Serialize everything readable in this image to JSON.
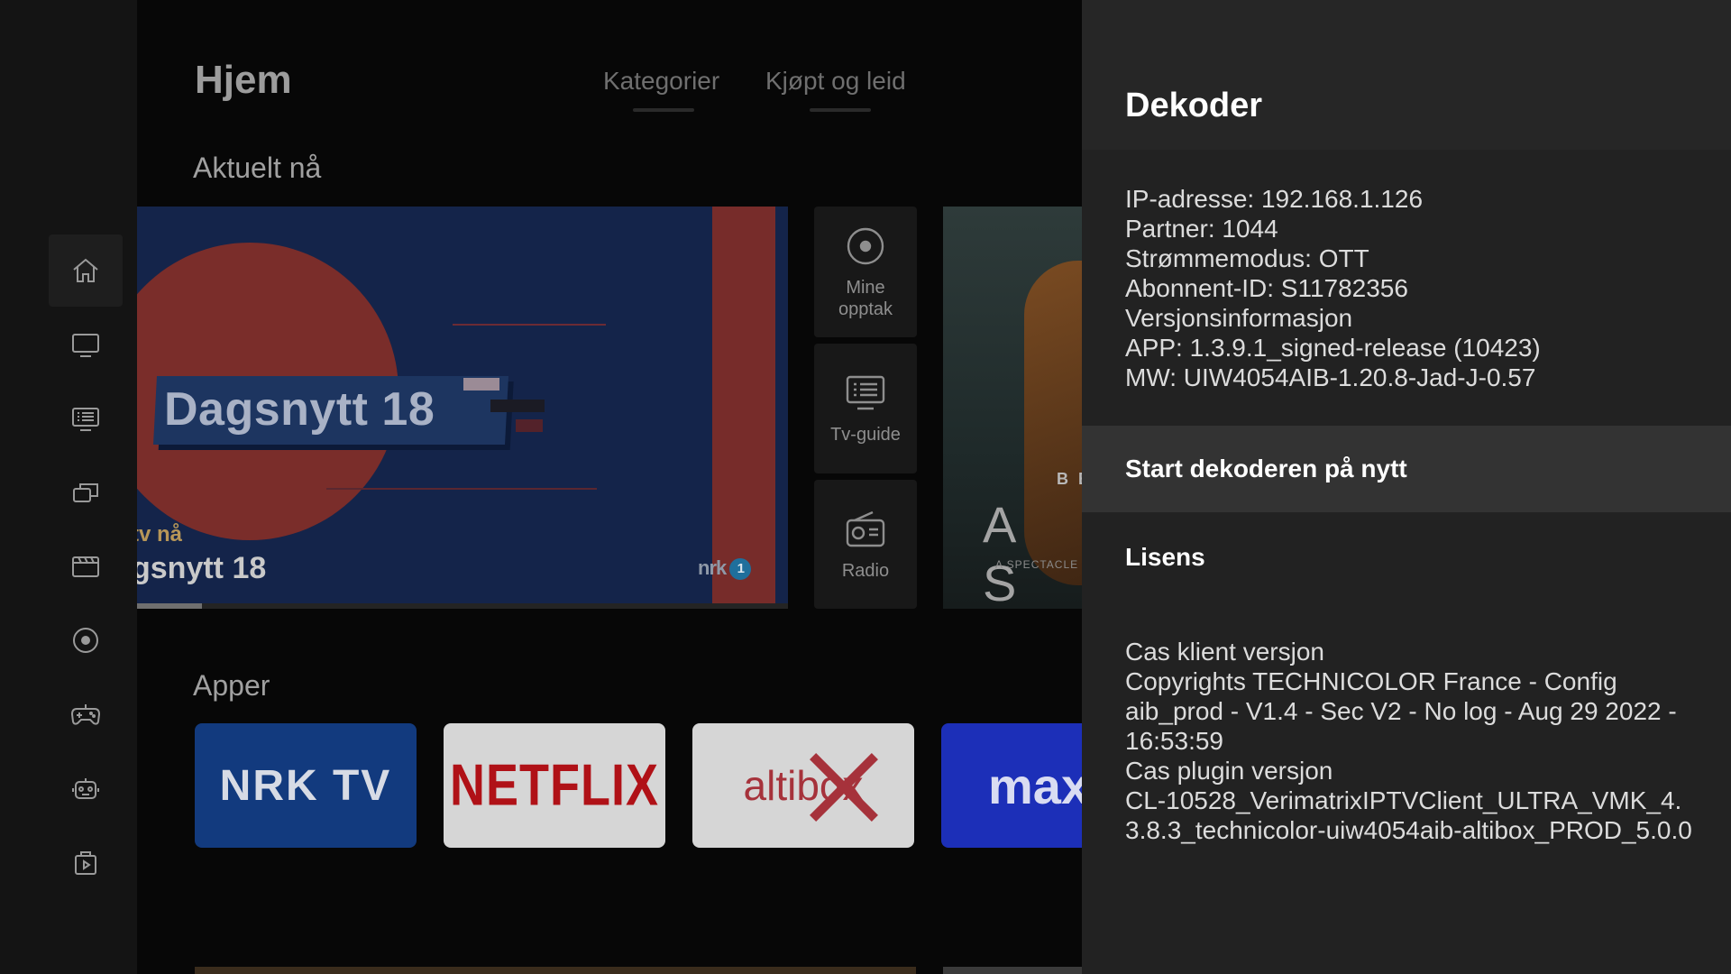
{
  "header": {
    "title": "Hjem",
    "tabs": [
      {
        "label": "Kategorier"
      },
      {
        "label": "Kjøpt og leid"
      }
    ]
  },
  "sections": {
    "current": "Aktuelt nå",
    "apps": "Apper"
  },
  "sidebar": {
    "items": [
      {
        "icon": "home-icon",
        "active": true
      },
      {
        "icon": "tv-icon"
      },
      {
        "icon": "tv-guide-icon"
      },
      {
        "icon": "multiscreen-icon"
      },
      {
        "icon": "movie-icon"
      },
      {
        "icon": "recordings-icon"
      },
      {
        "icon": "gamepad-icon"
      },
      {
        "icon": "kids-robot-icon"
      },
      {
        "icon": "store-bag-icon"
      }
    ]
  },
  "hero": {
    "plate_text": "Dagsnytt 18",
    "live_label": "tv nå",
    "show_title": "gsnytt 18",
    "channel_logo": "nrk",
    "channel_number": "1",
    "progress": 0.1
  },
  "quick_tiles": [
    {
      "label": "Mine\nopptak",
      "icon": "recordings-icon"
    },
    {
      "label": "Tv-guide",
      "icon": "tv-guide-icon"
    },
    {
      "label": "Radio",
      "icon": "radio-icon"
    }
  ],
  "hero2": {
    "brand": "B B",
    "title": "A S",
    "tagline": "A SPECTACLE L"
  },
  "apps": [
    {
      "label": "NRK TV",
      "bg": "#123a7e",
      "fg": "#d7dbe5"
    },
    {
      "label": "NETFLIX",
      "bg": "#d6d6d6",
      "fg": "#b01117"
    },
    {
      "label": "altibox",
      "bg": "#d6d6d6",
      "fg": "#a6323b"
    },
    {
      "label": "max",
      "bg": "#1c2fb8",
      "fg": "#d9dcf2"
    }
  ],
  "panel": {
    "title": "Dekoder",
    "info": [
      "IP-adresse: 192.168.1.126",
      "Partner: 1044",
      "Strømmemodus: OTT",
      "Abonnent-ID: S11782356",
      "Versjonsinformasjon",
      "APP: 1.3.9.1_signed-release (10423)",
      "MW: UIW4054AIB-1.20.8-Jad-J-0.57"
    ],
    "restart_label": "Start dekoderen på nytt",
    "license_label": "Lisens",
    "cas": [
      "Cas klient versjon",
      "Copyrights TECHNICOLOR France - Config aib_prod - V1.4 - Sec V2 - No log - Aug 29 2022 - 16:53:59",
      "Cas plugin versjon",
      "CL-10528_VerimatrixIPTVClient_ULTRA_VMK_4.3.8.3_technicolor-uiw4054aib-altibox_PROD_5.0.0"
    ]
  },
  "colors": {
    "panel_bg": "#222222",
    "selected_row": "#333333",
    "background": "#070707"
  }
}
